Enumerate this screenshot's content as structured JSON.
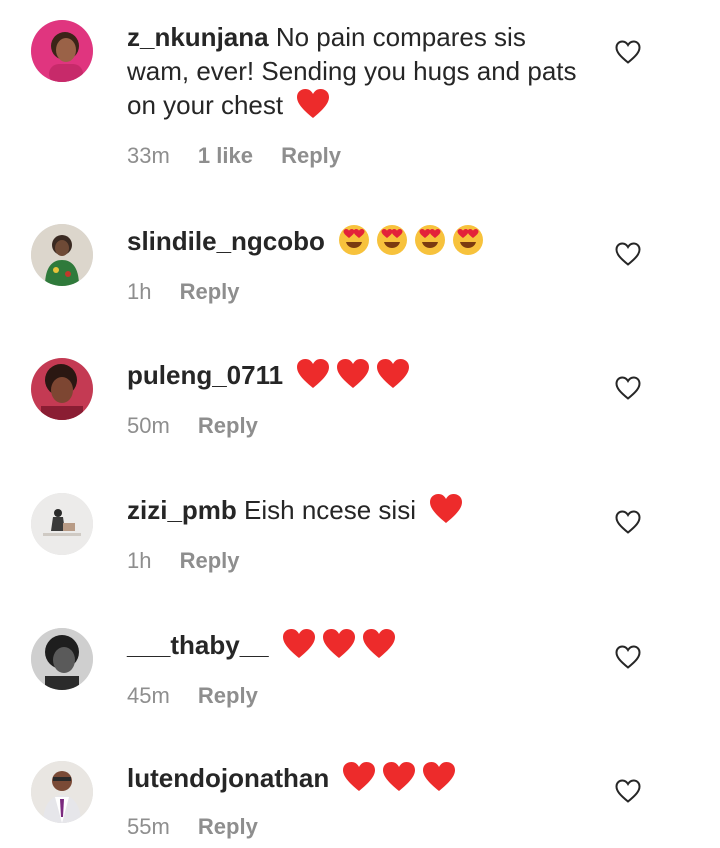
{
  "comments": [
    {
      "username": "z_nkunjana",
      "text": "No pain compares sis wam, ever! Sending you hugs and pats on your chest",
      "emojis": [
        "red-heart"
      ],
      "time": "33m",
      "likes": "1 like",
      "reply": "Reply"
    },
    {
      "username": "slindile_ngcobo",
      "text": "",
      "emojis": [
        "heart-eyes",
        "heart-eyes",
        "heart-eyes",
        "heart-eyes"
      ],
      "time": "1h",
      "likes": "",
      "reply": "Reply"
    },
    {
      "username": "puleng_0711",
      "text": "",
      "emojis": [
        "red-heart",
        "red-heart",
        "red-heart"
      ],
      "time": "50m",
      "likes": "",
      "reply": "Reply"
    },
    {
      "username": "zizi_pmb",
      "text": "Eish ncese sisi",
      "emojis": [
        "red-heart"
      ],
      "time": "1h",
      "likes": "",
      "reply": "Reply"
    },
    {
      "username": "___thaby__",
      "text": "",
      "emojis": [
        "red-heart",
        "red-heart",
        "red-heart"
      ],
      "time": "45m",
      "likes": "",
      "reply": "Reply"
    },
    {
      "username": "lutendojonathan",
      "text": "",
      "emojis": [
        "red-heart",
        "red-heart",
        "red-heart"
      ],
      "time": "55m",
      "likes": "",
      "reply": "Reply"
    }
  ],
  "colors": {
    "text": "#262626",
    "meta": "#8e8e8e",
    "heart": "#ed2b2b"
  }
}
